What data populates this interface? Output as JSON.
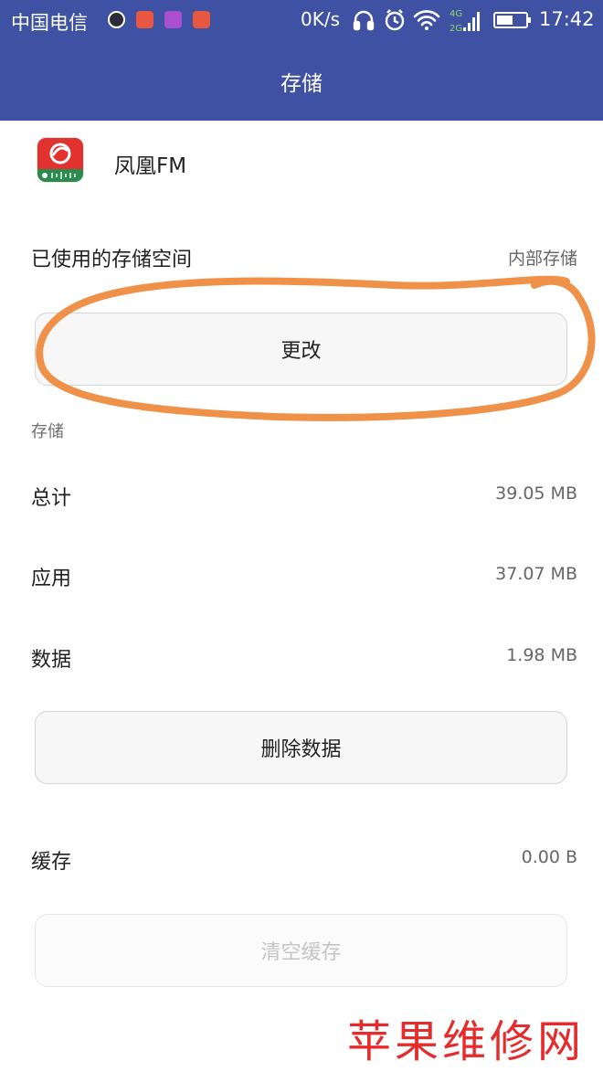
{
  "status_bar": {
    "carrier": "中国电信",
    "net_speed": "0K/s",
    "network_badges": [
      "4G",
      "2G"
    ],
    "time": "17:42",
    "battery_level": 0.55,
    "icons": [
      "record-icon",
      "heart-app-icon",
      "gallery-app-icon",
      "video-app-icon",
      "headphones-icon",
      "alarm-icon",
      "wifi-icon",
      "signal-icon",
      "battery-icon"
    ]
  },
  "title_bar": {
    "title": "存储"
  },
  "app": {
    "name": "凤凰FM",
    "icon": "phoenix-fm-app-icon"
  },
  "storage_used": {
    "label": "已使用的存储空间",
    "value": "内部存储"
  },
  "change_button": {
    "label": "更改"
  },
  "storage_section": {
    "label": "存储"
  },
  "rows": {
    "total": {
      "label": "总计",
      "value": "39.05 MB"
    },
    "app": {
      "label": "应用",
      "value": "37.07 MB"
    },
    "data": {
      "label": "数据",
      "value": "1.98 MB"
    }
  },
  "clear_data_button": {
    "label": "删除数据"
  },
  "cache": {
    "label": "缓存",
    "value": "0.00 B"
  },
  "clear_cache_button": {
    "label": "清空缓存"
  },
  "watermark": "苹果维修网",
  "colors": {
    "header": "#3f51a3",
    "annotation": "#f0914a",
    "watermark": "#e52b2b"
  }
}
